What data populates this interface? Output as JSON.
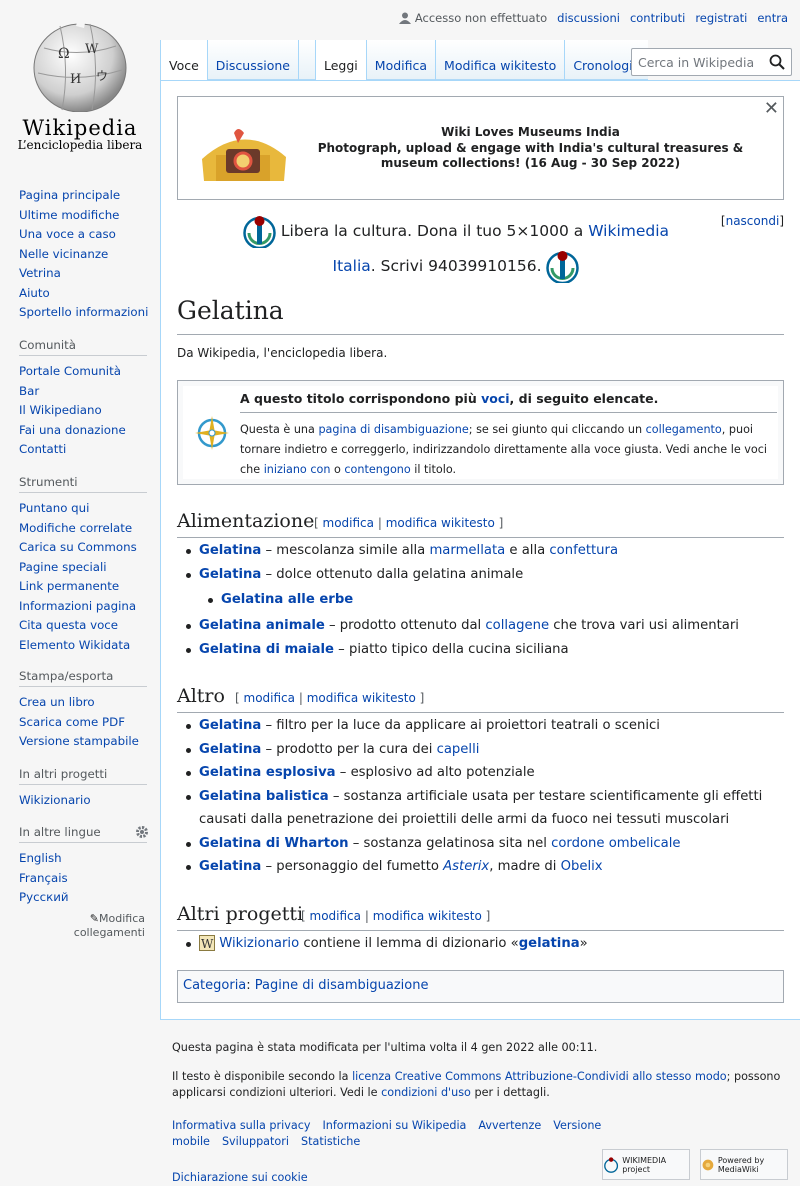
{
  "logo": {
    "wordmark": "Wikipedia",
    "tagline": "L’enciclopedia libera"
  },
  "personal": {
    "anon": "Accesso non effettuato",
    "links": [
      "discussioni",
      "contributi",
      "registrati",
      "entra"
    ]
  },
  "tabs": {
    "left": [
      "Voce",
      "Discussione"
    ],
    "right": [
      "Leggi",
      "Modifica",
      "Modifica wikitesto",
      "Cronologia"
    ]
  },
  "search": {
    "placeholder": "Cerca in Wikipedia"
  },
  "sidebar": {
    "nav": [
      "Pagina principale",
      "Ultime modifiche",
      "Una voce a caso",
      "Nelle vicinanze",
      "Vetrina",
      "Aiuto",
      "Sportello informazioni"
    ],
    "portals": [
      {
        "title": "Comunità",
        "items": [
          "Portale Comunità",
          "Bar",
          "Il Wikipediano",
          "Fai una donazione",
          "Contatti"
        ]
      },
      {
        "title": "Strumenti",
        "items": [
          "Puntano qui",
          "Modifiche correlate",
          "Carica su Commons",
          "Pagine speciali",
          "Link permanente",
          "Informazioni pagina",
          "Cita questa voce",
          "Elemento Wikidata"
        ]
      },
      {
        "title": "Stampa/esporta",
        "items": [
          "Crea un libro",
          "Scarica come PDF",
          "Versione stampabile"
        ]
      },
      {
        "title": "In altri progetti",
        "items": [
          "Wikizionario"
        ]
      },
      {
        "title": "In altre lingue",
        "items": [
          "English",
          "Français",
          "Русский"
        ]
      }
    ],
    "edit_links": "Modifica collegamenti"
  },
  "banner": {
    "title": "Wiki Loves Museums India",
    "text": "Photograph, upload & engage with India's cultural treasures & museum collections! (16 Aug - 30 Sep 2022)",
    "close": "✕"
  },
  "donate": {
    "pre": "Libera la cultura. Dona il tuo 5×1000 a ",
    "link": "Wikimedia Italia",
    "post": ". Scrivi 94039910156.",
    "hide": "nascondi"
  },
  "article": {
    "title": "Gelatina",
    "from": "Da Wikipedia, l'enciclopedia libera.",
    "dis_title_pre": "A questo titolo corrispondono più ",
    "dis_title_link": "voci",
    "dis_title_post": ", di seguito elencate.",
    "dis_t1": "Questa è una ",
    "dis_l1": "pagina di disambiguazione",
    "dis_t2": "; se sei giunto qui cliccando un ",
    "dis_l2": "collegamento",
    "dis_t3": ", puoi tornare indietro e correggerlo, indirizzandolo direttamente alla voce giusta. Vedi anche le voci che ",
    "dis_l3": "iniziano con",
    "dis_t4": " o ",
    "dis_l4": "contengono",
    "dis_t5": " il titolo."
  },
  "edit": {
    "open": "[",
    "modifica": "modifica",
    "sep": "|",
    "wikitesto": "modifica wikitesto",
    "close": "]"
  },
  "sections": {
    "alimentazione": "Alimentazione",
    "altro": "Altro",
    "altri_progetti": "Altri progetti"
  },
  "ali": {
    "g": "Gelatina",
    "dash": " – ",
    "i1": "mescolanza simile alla ",
    "i1a": "marmellata",
    "i1b": " e alla ",
    "i1c": "confettura",
    "i2": "dolce ottenuto dalla gelatina animale",
    "i3": "Gelatina alle erbe",
    "i4l": "Gelatina animale",
    "i4": "prodotto ottenuto dal ",
    "i4a": "collagene",
    "i4b": " che trova vari usi alimentari",
    "i5l": "Gelatina di maiale",
    "i5": "piatto tipico della cucina siciliana"
  },
  "alt": {
    "i1": "filtro per la luce da applicare ai proiettori teatrali o scenici",
    "i2": "prodotto per la cura dei ",
    "i2a": "capelli",
    "i3l": "Gelatina esplosiva",
    "i3": "esplosivo ad alto potenziale",
    "i4l": "Gelatina balistica",
    "i4": "sostanza artificiale usata per testare scientificamente gli effetti causati dalla penetrazione dei proiettili delle armi da fuoco nei tessuti muscolari",
    "i5l": "Gelatina di Wharton",
    "i5": "sostanza gelatinosa sita nel ",
    "i5a": "cordone ombelicale",
    "i6": "personaggio del fumetto ",
    "i6a": "Asterix",
    "i6b": ", madre di ",
    "i6c": "Obelix"
  },
  "proj": {
    "link": "Wikizionario",
    "pre": " contiene il lemma di dizionario «",
    "word": "gelatina",
    "post": "»"
  },
  "cats": {
    "label": "Categoria",
    "colon": ": ",
    "item": "Pagine di disambiguazione"
  },
  "footer": {
    "lastmod": "Questa pagina è stata modificata per l'ultima volta il 4 gen 2022 alle 00:11.",
    "lic_pre": "Il testo è disponibile secondo la ",
    "lic_link": "licenza Creative Commons Attribuzione-Condividi allo stesso modo",
    "lic_mid": "; possono applicarsi condizioni ulteriori. Vedi le ",
    "lic_link2": "condizioni d'uso",
    "lic_post": " per i dettagli.",
    "places": [
      "Informativa sulla privacy",
      "Informazioni su Wikipedia",
      "Avvertenze",
      "Versione mobile",
      "Sviluppatori",
      "Statistiche",
      "Dichiarazione sui cookie"
    ],
    "badge1": "WIKIMEDIA project",
    "badge2": "Powered by MediaWiki"
  },
  "colors": {
    "link": "#0645ad",
    "border": "#a2a9b1",
    "tab_border": "#a7d7f9"
  }
}
